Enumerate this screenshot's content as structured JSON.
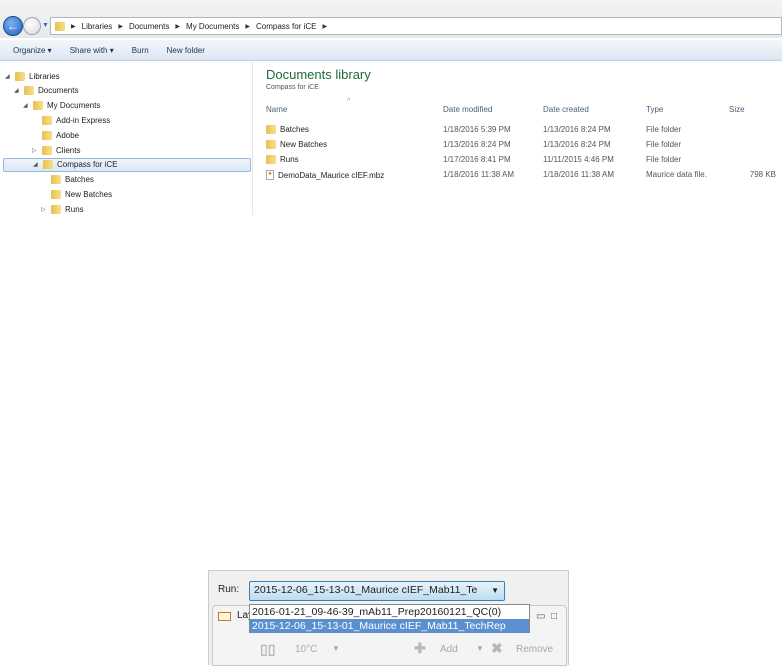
{
  "explorer": {
    "breadcrumb": [
      "Libraries",
      "Documents",
      "My Documents",
      "Compass for iCE"
    ],
    "toolbar": {
      "organize": "Organize ▾",
      "share": "Share with ▾",
      "burn": "Burn",
      "new_folder": "New folder"
    },
    "tree": [
      {
        "label": "Libraries",
        "level": 0,
        "exp": "◢"
      },
      {
        "label": "Documents",
        "level": 1,
        "exp": "◢"
      },
      {
        "label": "My Documents",
        "level": 2,
        "exp": "◢"
      },
      {
        "label": "Add-in Express",
        "level": 3,
        "exp": ""
      },
      {
        "label": "Adobe",
        "level": 3,
        "exp": ""
      },
      {
        "label": "Clients",
        "level": 3,
        "exp": "▷"
      },
      {
        "label": "Compass for iCE",
        "level": 3,
        "exp": "◢",
        "selected": true
      },
      {
        "label": "Batches",
        "level": 4,
        "exp": ""
      },
      {
        "label": "New Batches",
        "level": 4,
        "exp": ""
      },
      {
        "label": "Runs",
        "level": 4,
        "exp": "▷"
      }
    ],
    "library_title": "Documents library",
    "library_subtitle": "Compass for iCE",
    "columns": [
      "Name",
      "Date modified",
      "Date created",
      "Type",
      "Size"
    ],
    "files": [
      {
        "name": "Batches",
        "modified": "1/18/2016 5:39 PM",
        "created": "1/13/2016 8:24 PM",
        "type": "File folder",
        "size": "",
        "icon": "folder"
      },
      {
        "name": "New Batches",
        "modified": "1/13/2016 8:24 PM",
        "created": "1/13/2016 8:24 PM",
        "type": "File folder",
        "size": "",
        "icon": "folder"
      },
      {
        "name": "Runs",
        "modified": "1/17/2016 8:41 PM",
        "created": "11/11/2015 4:46 PM",
        "type": "File folder",
        "size": "",
        "icon": "folder"
      },
      {
        "name": "DemoData_Maurice cIEF.mbz",
        "modified": "1/18/2016 11:38 AM",
        "created": "1/18/2016 11:38 AM",
        "type": "Maurice data file.",
        "size": "798 KB",
        "icon": "file"
      }
    ]
  },
  "panel": {
    "run_label": "Run:",
    "run_value": "2015-12-06_15-13-01_Maurice cIEF_Mab11_Te",
    "options": [
      "2016-01-21_09-46-39_mAb11_Prep20160121_QC(0)",
      "2015-12-06_15-13-01_Maurice cIEF_Mab11_TechRep"
    ],
    "selected_option": 1,
    "tab_label": "Lay",
    "temperature": "10°C",
    "add_label": "Add",
    "remove_label": "Remove"
  }
}
